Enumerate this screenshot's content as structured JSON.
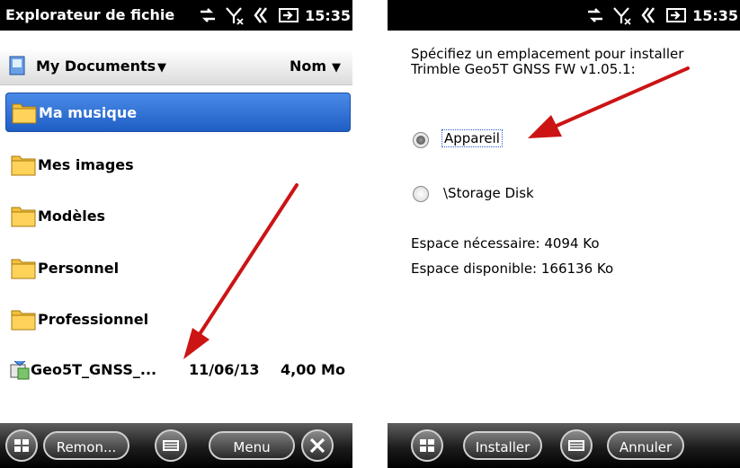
{
  "left_screen": {
    "status": {
      "title": "Explorateur de fichie",
      "time": "15:35"
    },
    "header": {
      "folder": "My Documents",
      "sort": "Nom"
    },
    "folders": [
      {
        "label": "Ma musique",
        "selected": true
      },
      {
        "label": "Mes images",
        "selected": false
      },
      {
        "label": "Modèles",
        "selected": false
      },
      {
        "label": "Personnel",
        "selected": false
      },
      {
        "label": "Professionnel",
        "selected": false
      }
    ],
    "file": {
      "name": "Geo5T_GNSS_...",
      "date": "11/06/13",
      "size": "4,00 Mo"
    },
    "softkeys": {
      "left": "Remon...",
      "right": "Menu"
    }
  },
  "right_screen": {
    "status": {
      "time": "15:35"
    },
    "prompt": "Spécifiez un emplacement pour installer Trimble Geo5T GNSS FW v1.05.1:",
    "options": [
      {
        "label": "Appareil",
        "checked": true
      },
      {
        "label": "\\Storage Disk",
        "checked": false
      }
    ],
    "space_needed": "Espace nécessaire:  4094 Ko",
    "space_available": "Espace disponible: 166136 Ko",
    "softkeys": {
      "left": "Installer",
      "right": "Annuler"
    }
  },
  "colors": {
    "selection": "#2a6ad6",
    "arrow": "#d01818",
    "statusbar": "#000000"
  },
  "icons": [
    "windows-start-icon",
    "keyboard-icon",
    "close-icon",
    "folder-icon",
    "document-icon",
    "installer-icon",
    "signal-icon",
    "volume-icon",
    "battery-icon",
    "sync-icon"
  ]
}
